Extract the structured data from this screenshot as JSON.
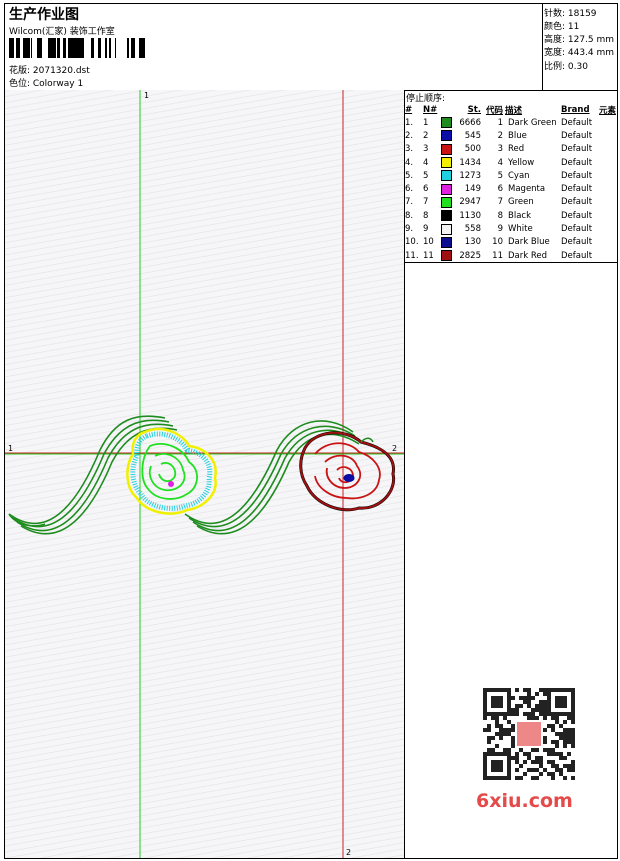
{
  "header": {
    "title": "生产作业图",
    "company": "Wilcom(汇家) 装饰工作室",
    "pattern": "花版: 2071320.dst",
    "colorway": "色位: Colorway 1"
  },
  "stats": [
    "针数: 18159",
    "颜色: 11",
    "高度: 127.5 mm",
    "宽度: 443.4 mm",
    "比例: 0.30"
  ],
  "stop_sequence": {
    "title": "停止顺序:",
    "columns": [
      "#",
      "N#",
      "St.",
      "代码",
      "描述",
      "Brand",
      "元素"
    ],
    "rows": [
      {
        "idx": "1.",
        "n": "1",
        "color": "#1e8c1e",
        "st": "6666",
        "code": "1",
        "desc": "Dark Green",
        "brand": "Default"
      },
      {
        "idx": "2.",
        "n": "2",
        "color": "#0d0da8",
        "st": "545",
        "code": "2",
        "desc": "Blue",
        "brand": "Default"
      },
      {
        "idx": "3.",
        "n": "3",
        "color": "#c81414",
        "st": "500",
        "code": "3",
        "desc": "Red",
        "brand": "Default"
      },
      {
        "idx": "4.",
        "n": "4",
        "color": "#f0f000",
        "st": "1434",
        "code": "4",
        "desc": "Yellow",
        "brand": "Default"
      },
      {
        "idx": "5.",
        "n": "5",
        "color": "#20d0e0",
        "st": "1273",
        "code": "5",
        "desc": "Cyan",
        "brand": "Default"
      },
      {
        "idx": "6.",
        "n": "6",
        "color": "#e020e0",
        "st": "149",
        "code": "6",
        "desc": "Magenta",
        "brand": "Default"
      },
      {
        "idx": "7.",
        "n": "7",
        "color": "#20e020",
        "st": "2947",
        "code": "7",
        "desc": "Green",
        "brand": "Default"
      },
      {
        "idx": "8.",
        "n": "8",
        "color": "#000000",
        "st": "1130",
        "code": "8",
        "desc": "Black",
        "brand": "Default"
      },
      {
        "idx": "9.",
        "n": "9",
        "color": "#f4f4f4",
        "st": "558",
        "code": "9",
        "desc": "White",
        "brand": "Default"
      },
      {
        "idx": "10.",
        "n": "10",
        "color": "#0c0c90",
        "st": "130",
        "code": "10",
        "desc": "Dark Blue",
        "brand": "Default"
      },
      {
        "idx": "11.",
        "n": "11",
        "color": "#a01010",
        "st": "2825",
        "code": "11",
        "desc": "Dark Red",
        "brand": "Default"
      }
    ]
  },
  "axes": {
    "v1_label": "1",
    "h1_label": "1",
    "h2_label": "2",
    "v2_label": "2"
  },
  "watermark": "6xiu.com"
}
